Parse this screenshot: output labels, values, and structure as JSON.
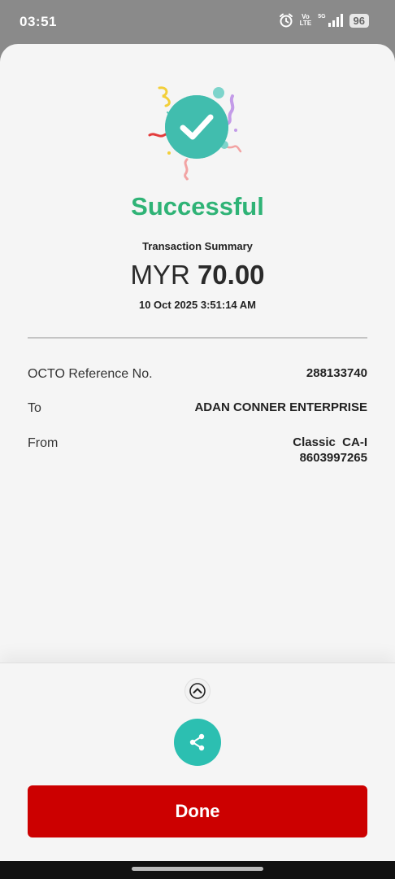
{
  "status_bar": {
    "time": "03:51",
    "volte_top": "Vo",
    "volte_bottom": "LTE",
    "network": "5G",
    "battery": "96",
    "icons": [
      "alarm-icon",
      "volte-icon",
      "signal-icon",
      "battery-icon"
    ]
  },
  "receipt": {
    "title": "Successful",
    "summary_label": "Transaction Summary",
    "currency": "MYR",
    "amount": "70.00",
    "datetime": "10 Oct 2025 3:51:14 AM",
    "rows": [
      {
        "label": "OCTO Reference No.",
        "value": "288133740"
      },
      {
        "label": "To",
        "value": "ADAN CONNER ENTERPRISE"
      },
      {
        "label": "From",
        "value_line1": "Classic  CA-I",
        "value_line2": "8603997265"
      }
    ]
  },
  "actions": {
    "expand_icon": "chevron-up-icon",
    "share_icon": "share-icon",
    "done_label": "Done"
  },
  "colors": {
    "success": "#2fb376",
    "accent_teal": "#2cbfb1",
    "done_red": "#cc0000",
    "background": "#f5f5f5"
  }
}
